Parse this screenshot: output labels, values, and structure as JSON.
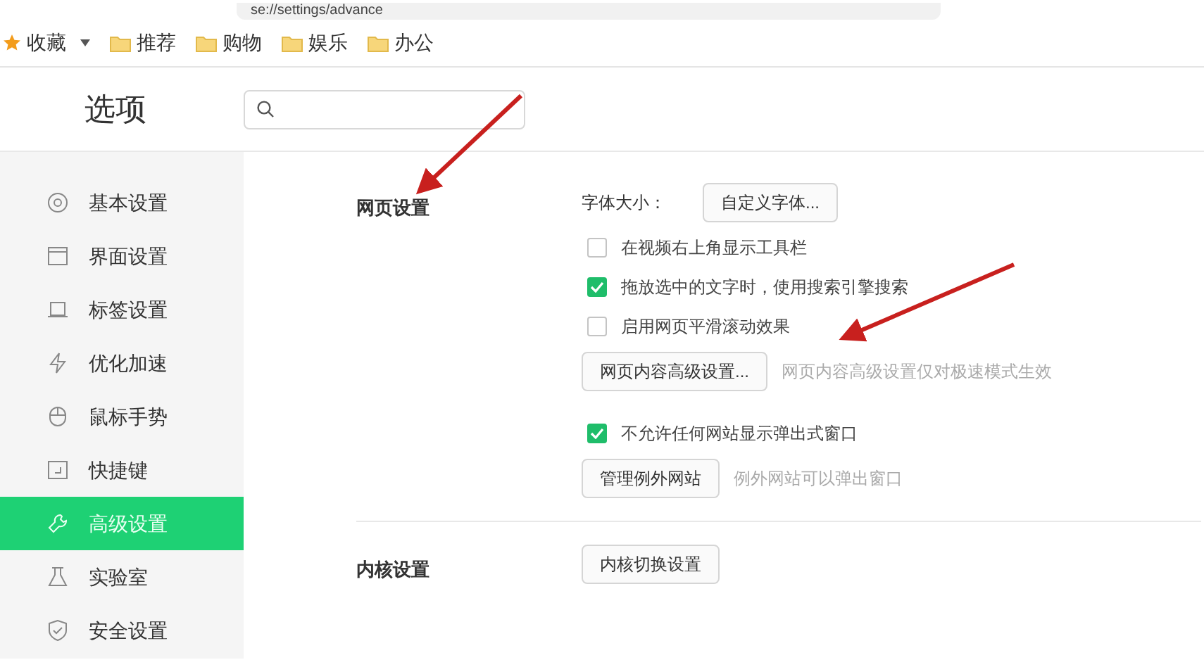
{
  "address_bar": {
    "url": "se://settings/advance"
  },
  "bookmarks": [
    {
      "label": "收藏",
      "kind": "favorites"
    },
    {
      "label": "推荐",
      "kind": "folder"
    },
    {
      "label": "购物",
      "kind": "folder"
    },
    {
      "label": "娱乐",
      "kind": "folder"
    },
    {
      "label": "办公",
      "kind": "folder"
    }
  ],
  "page_title": "选项",
  "sidebar": {
    "items": [
      {
        "label": "基本设置",
        "selected": false
      },
      {
        "label": "界面设置",
        "selected": false
      },
      {
        "label": "标签设置",
        "selected": false
      },
      {
        "label": "优化加速",
        "selected": false
      },
      {
        "label": "鼠标手势",
        "selected": false
      },
      {
        "label": "快捷键",
        "selected": false
      },
      {
        "label": "高级设置",
        "selected": true
      },
      {
        "label": "实验室",
        "selected": false
      },
      {
        "label": "安全设置",
        "selected": false
      }
    ]
  },
  "sections": [
    {
      "heading": "网页设置",
      "groups": [
        [
          {
            "kind": "labeled_button",
            "label": "字体大小：",
            "button": "自定义字体..."
          },
          {
            "kind": "checkbox",
            "label": "在视频右上角显示工具栏",
            "checked": false
          },
          {
            "kind": "checkbox",
            "label": "拖放选中的文字时，使用搜索引擎搜索",
            "checked": true
          },
          {
            "kind": "checkbox",
            "label": "启用网页平滑滚动效果",
            "checked": false
          },
          {
            "kind": "button_note",
            "button": "网页内容高级设置...",
            "note": "网页内容高级设置仅对极速模式生效"
          }
        ],
        [
          {
            "kind": "checkbox",
            "label": "不允许任何网站显示弹出式窗口",
            "checked": true
          },
          {
            "kind": "button_note",
            "button": "管理例外网站",
            "note": "例外网站可以弹出窗口"
          }
        ]
      ]
    },
    {
      "heading": "内核设置",
      "groups": [
        [
          {
            "kind": "button_note",
            "button": "内核切换设置"
          }
        ]
      ]
    }
  ]
}
